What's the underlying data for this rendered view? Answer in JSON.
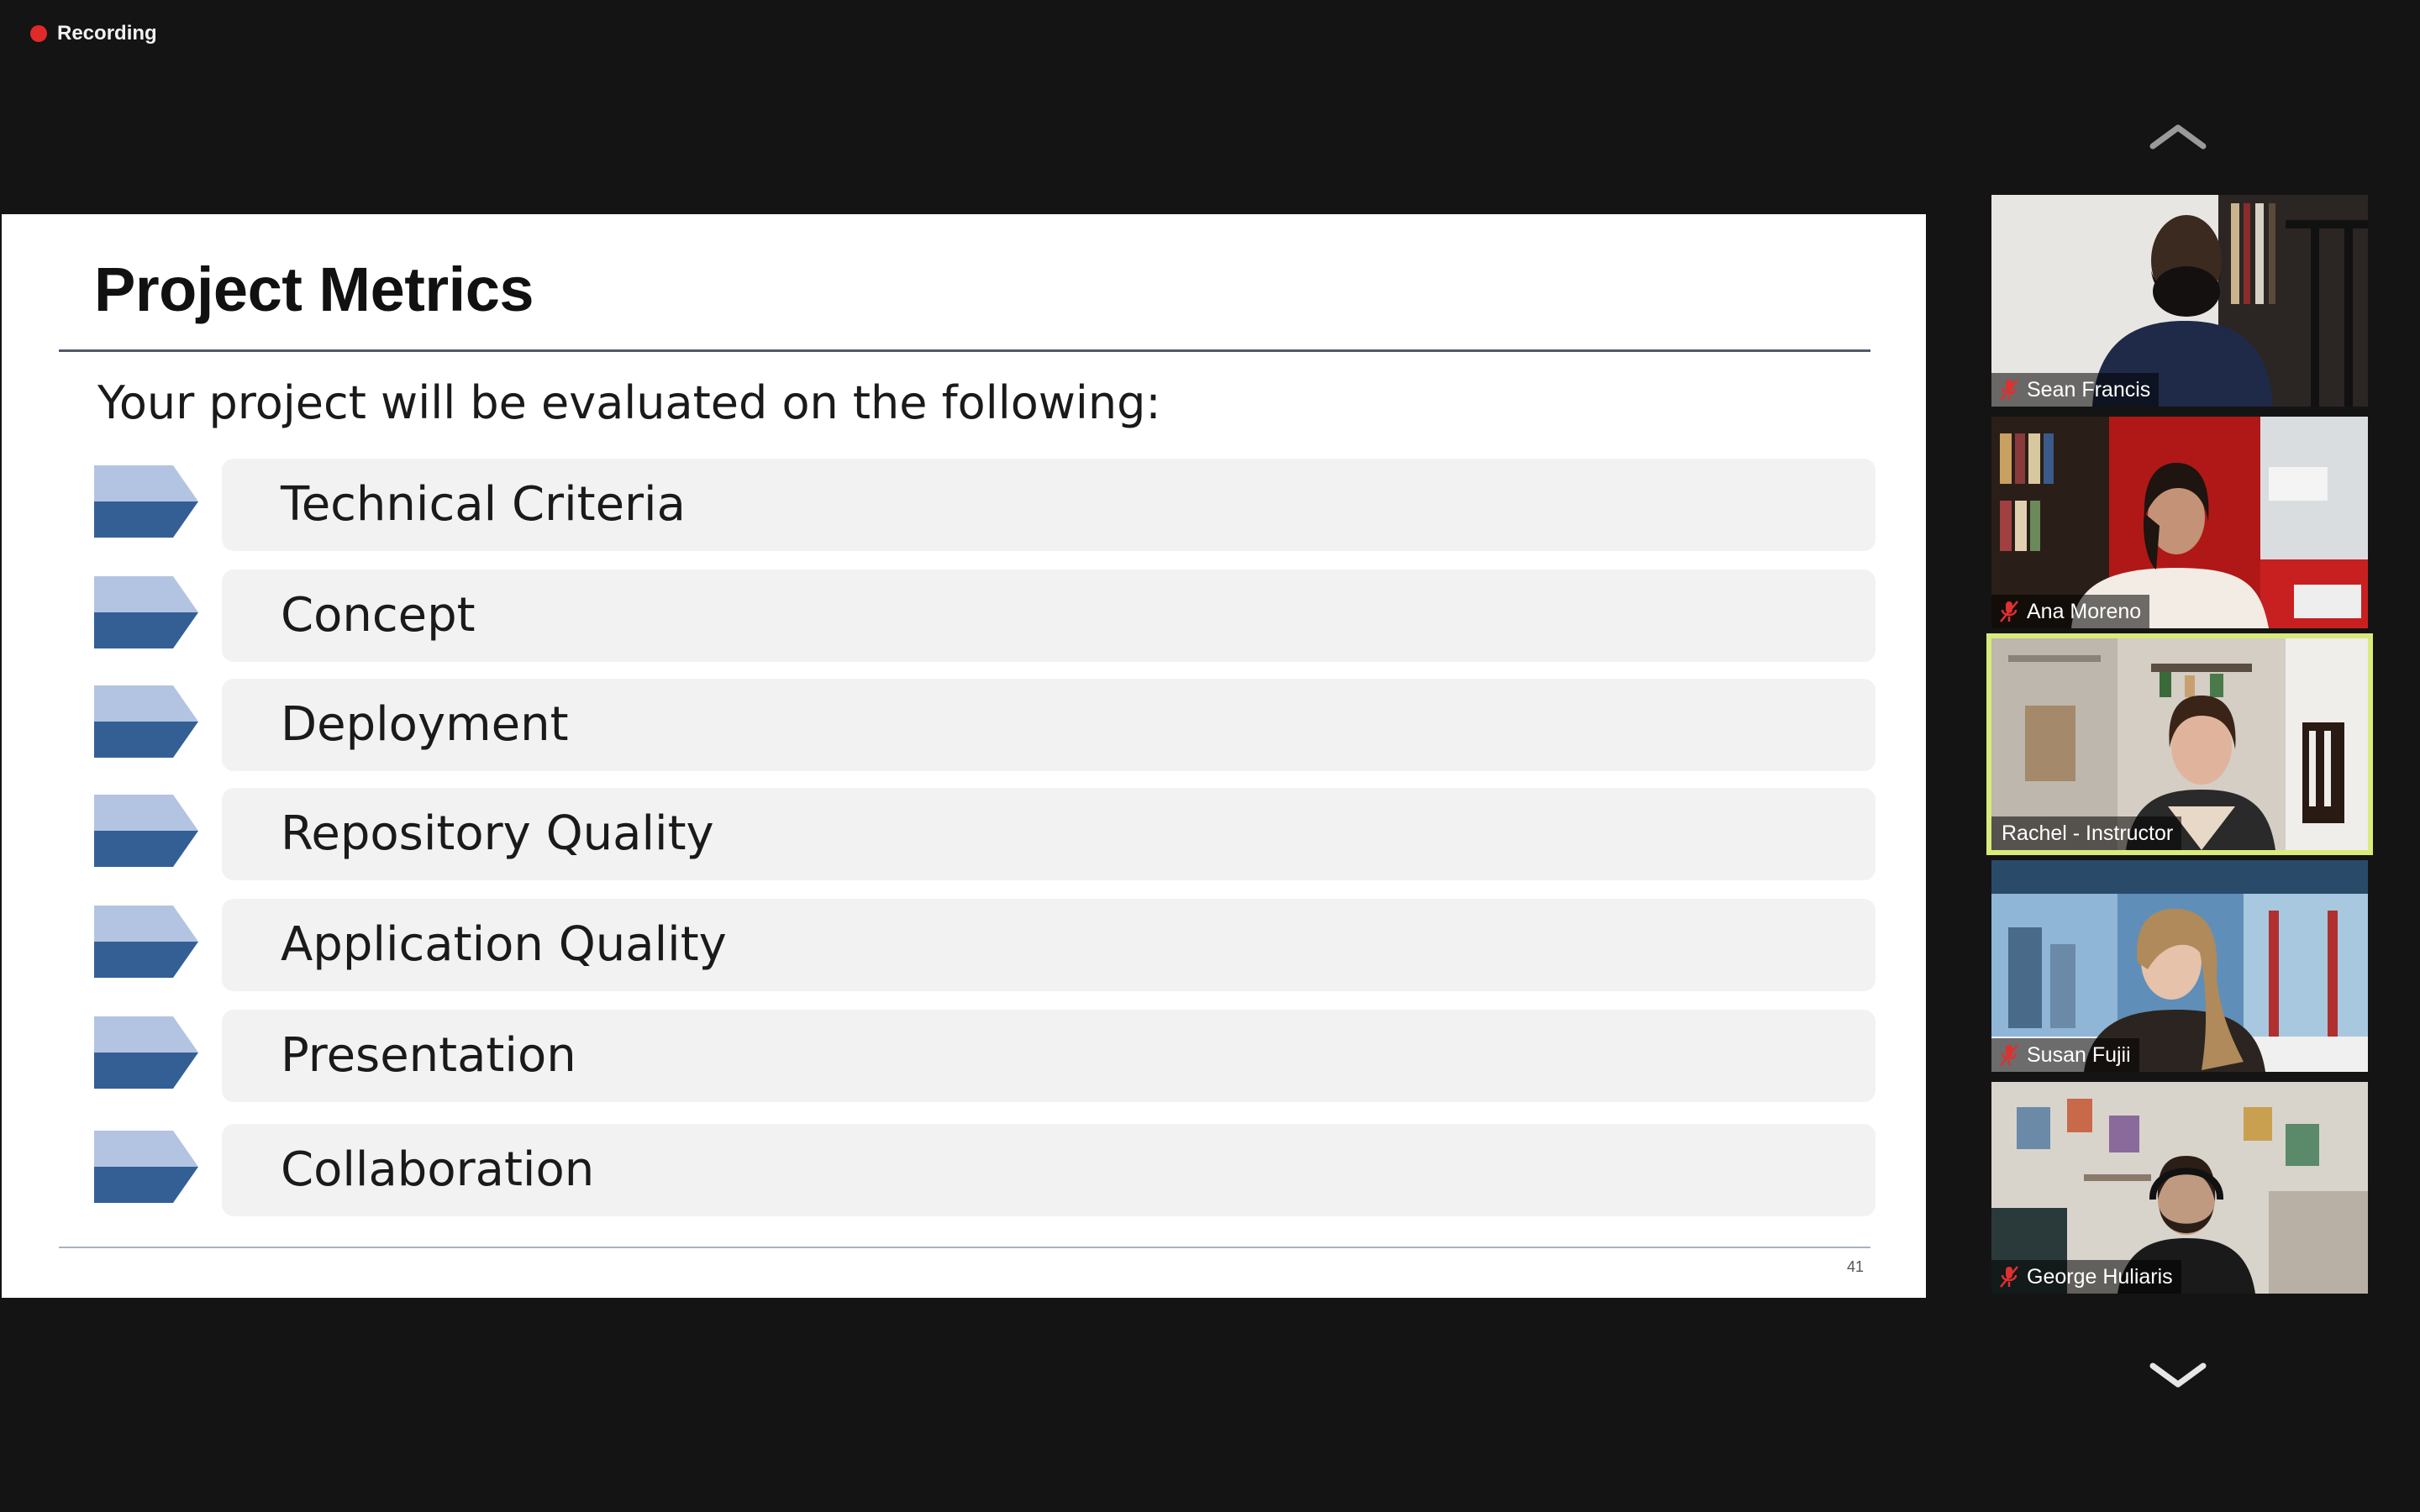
{
  "recording": {
    "label": "Recording",
    "color": "#e02a2a"
  },
  "slide": {
    "title": "Project Metrics",
    "subtitle": "Your project will be evaluated on the following:",
    "items": [
      "Technical Criteria",
      "Concept",
      "Deployment",
      "Repository Quality",
      "Application Quality",
      "Presentation",
      "Collaboration"
    ],
    "page_number": "41",
    "arrow_colors": {
      "light": "#b3c4e2",
      "dark": "#335f95"
    }
  },
  "participants": [
    {
      "name": "Sean Francis",
      "muted": true,
      "active_speaker": false
    },
    {
      "name": "Ana Moreno",
      "muted": true,
      "active_speaker": false
    },
    {
      "name": "Rachel - Instructor",
      "muted": false,
      "active_speaker": true
    },
    {
      "name": "Susan Fujii",
      "muted": true,
      "active_speaker": false
    },
    {
      "name": "George Huliaris",
      "muted": true,
      "active_speaker": false
    }
  ],
  "navigation": {
    "up_icon": "chevron-up-icon",
    "down_icon": "chevron-down-icon"
  },
  "colors": {
    "background": "#141414",
    "active_speaker_border": "#d9eb7a",
    "muted_mic": "#e03030"
  }
}
